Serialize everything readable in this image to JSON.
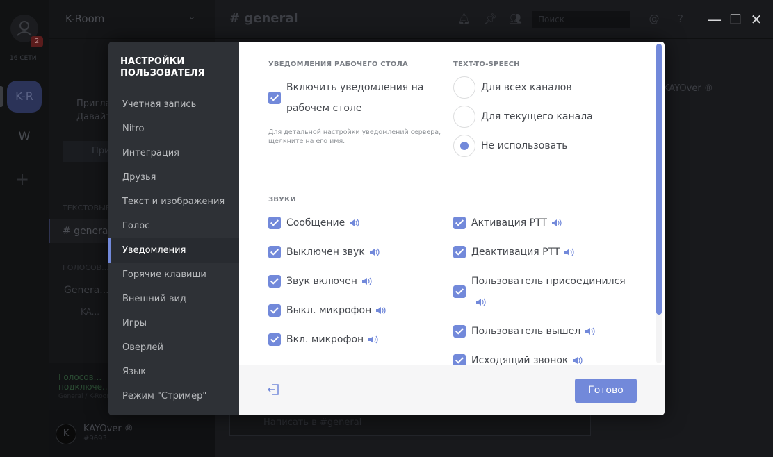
{
  "window": {
    "minimize": "—",
    "maximize": "☐",
    "close": "✕"
  },
  "background": {
    "server_badge": "2",
    "online_label": "16 СЕТИ",
    "server_kr": "K-R",
    "server_w": "W",
    "server_add": "+",
    "guild_name": "K-Room",
    "invite_text_1": "Приглас...",
    "invite_text_2": "Давайте...",
    "invite_button": "При...",
    "text_channels_label": "ТЕКСТОВЫЕ...",
    "general_channel": "# general",
    "voice_channels_label": "ГОЛОСОВ...",
    "voice_channel": "Genera...",
    "voice_user": "KA...",
    "voice_status_1": "Голосов...",
    "voice_status_2": "подключе...",
    "voice_status_3": "General / K-Room",
    "user_name": "KAYOver ®",
    "user_tag": "#9693",
    "header_channel": "# general",
    "search_placeholder": "Поиск",
    "member_name": "KAYOver ®",
    "message_placeholder": "Написать в #general"
  },
  "settings": {
    "title": "НАСТРОЙКИ ПОЛЬЗОВАТЕЛЯ",
    "nav": [
      {
        "label": "Учетная запись"
      },
      {
        "label": "Nitro"
      },
      {
        "label": "Интеграция"
      },
      {
        "label": "Друзья"
      },
      {
        "label": "Текст и изображения"
      },
      {
        "label": "Голос"
      },
      {
        "label": "Уведомления"
      },
      {
        "label": "Горячие клавиши"
      },
      {
        "label": "Внешний вид"
      },
      {
        "label": "Игры"
      },
      {
        "label": "Оверлей"
      },
      {
        "label": "Язык"
      },
      {
        "label": "Режим \"Стример\""
      }
    ],
    "active_nav_index": 6,
    "desktop_notifications": {
      "heading": "УВЕДОМЛЕНИЯ РАБОЧЕГО СТОЛА",
      "enable_label_1": "Включить уведомления на",
      "enable_label_2": "рабочем столе",
      "enabled": true,
      "hint_1": "Для детальной настройки уведомлений сервера,",
      "hint_2": "щелкните на его имя."
    },
    "tts": {
      "heading": "TEXT-TO-SPEECH",
      "options": [
        {
          "label": "Для всех каналов",
          "selected": false
        },
        {
          "label": "Для текущего канала",
          "selected": false
        },
        {
          "label": "Не использовать",
          "selected": true
        }
      ]
    },
    "sounds": {
      "heading": "ЗВУКИ",
      "left": [
        {
          "label": "Сообщение",
          "checked": true
        },
        {
          "label": "Выключен звук",
          "checked": true
        },
        {
          "label": "Звук включен",
          "checked": true
        },
        {
          "label": "Выкл. микрофон",
          "checked": true
        },
        {
          "label": "Вкл. микрофон",
          "checked": true
        }
      ],
      "right": [
        {
          "label": "Активация PTT",
          "checked": true
        },
        {
          "label": "Деактивация PTT",
          "checked": true
        },
        {
          "label": "Пользователь присоединился",
          "checked": true
        },
        {
          "label": "Пользователь вышел",
          "checked": true
        },
        {
          "label": "Исходящий звонок",
          "checked": true
        }
      ]
    },
    "done_button": "Готово",
    "accent_color": "#7289da"
  }
}
